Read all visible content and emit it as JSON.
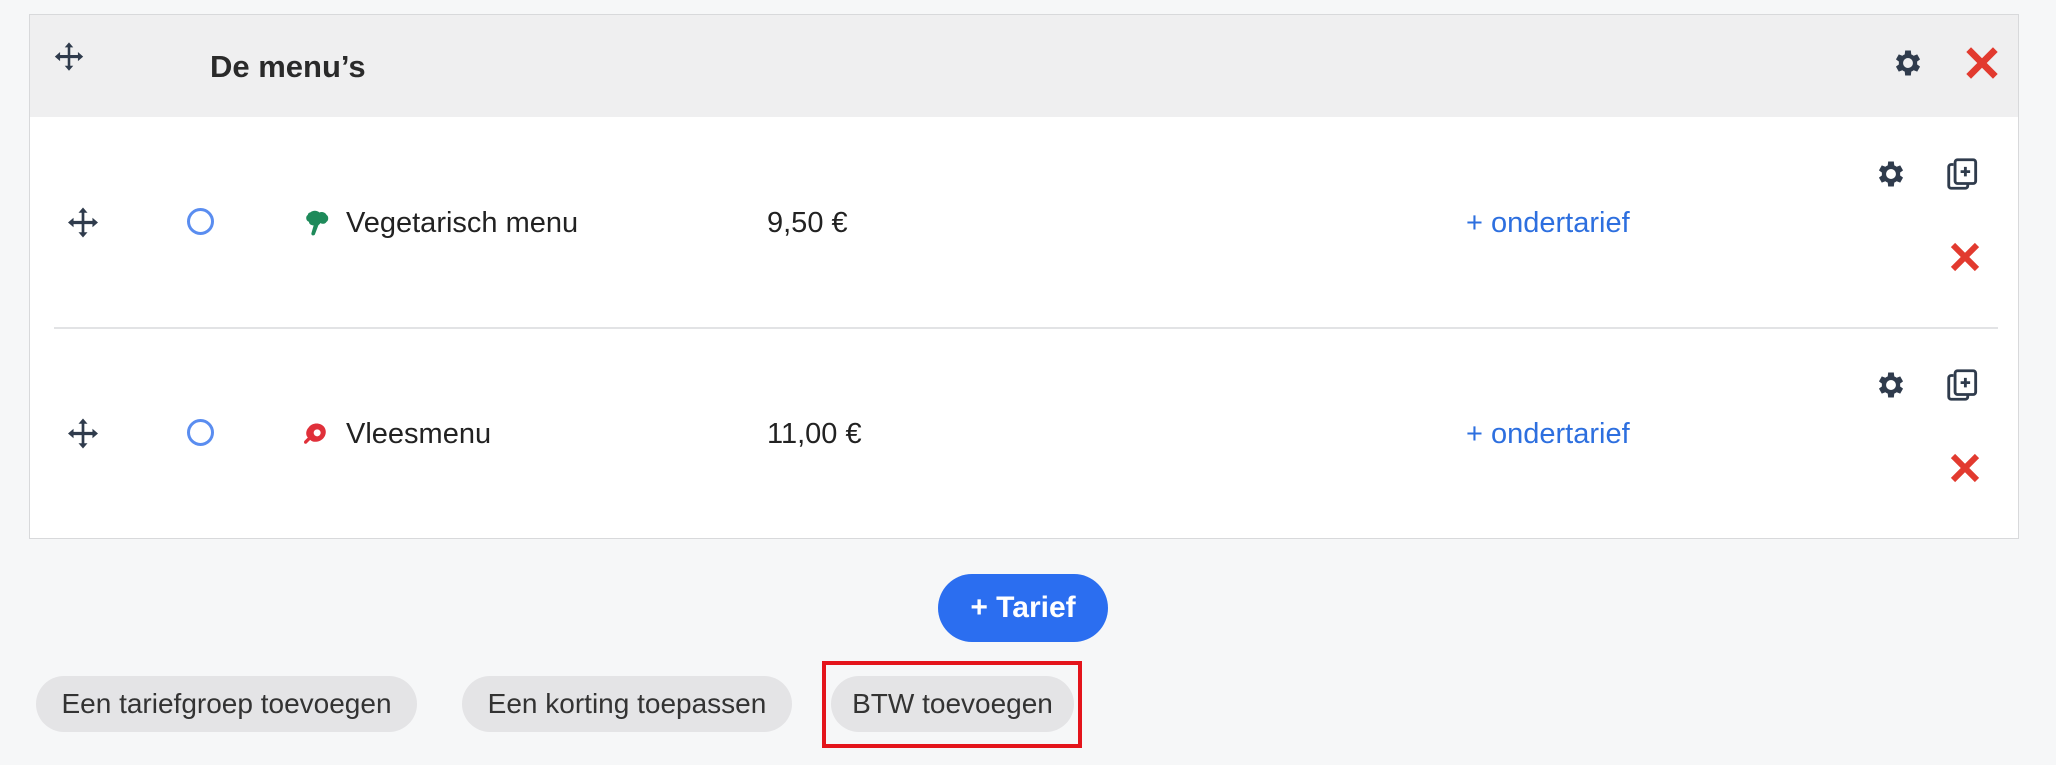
{
  "group": {
    "title": "De menu’s",
    "icons": {
      "drag": "move-arrows-icon",
      "settings": "gear-icon",
      "delete": "close-icon"
    }
  },
  "rates": [
    {
      "name": "Vegetarisch menu",
      "price": "9,50 €",
      "icon": "broccoli-icon",
      "icon_color": "#1e8a5a",
      "sub_link": "+ ondertarief"
    },
    {
      "name": "Vleesmenu",
      "price": "11,00 €",
      "icon": "meat-icon",
      "icon_color": "#e0303a",
      "sub_link": "+ ondertarief"
    }
  ],
  "buttons": {
    "add_rate": "+ Tarief",
    "add_group": "Een tariefgroep toevoegen",
    "apply_discount": "Een korting toepassen",
    "add_vat": "BTW toevoegen"
  },
  "colors": {
    "accent": "#2b6ef0",
    "link": "#2d6fdf",
    "delete": "#e23a2f",
    "icon_dark": "#2f3b4c",
    "highlight": "#e4141b"
  }
}
